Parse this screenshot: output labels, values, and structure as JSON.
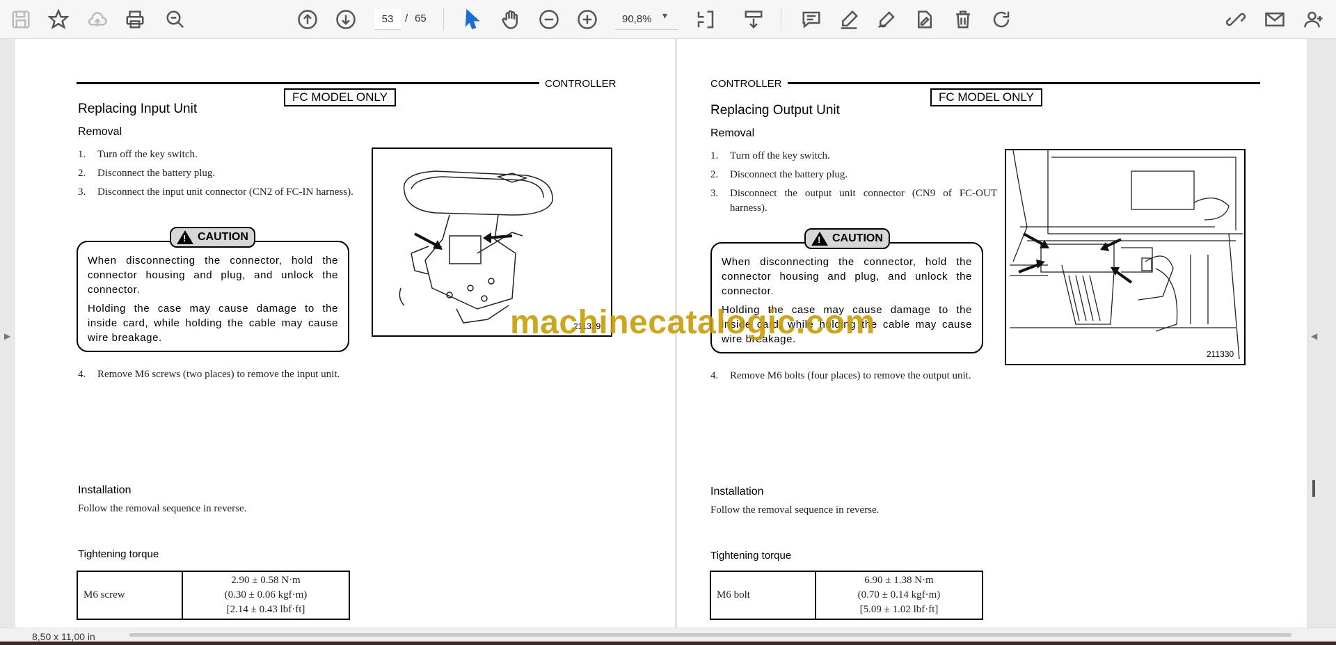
{
  "toolbar": {
    "icons": [
      "save-icon",
      "star-icon",
      "cloud-upload-icon",
      "print-icon",
      "zoom-search-icon",
      "page-up-icon",
      "page-down-icon",
      "pointer-icon",
      "hand-icon",
      "zoom-out-icon",
      "zoom-in-icon",
      "fit-page-icon",
      "scroll-mode-icon",
      "comment-icon",
      "highlight-pen-icon",
      "draw-icon",
      "sign-icon",
      "delete-icon",
      "rotate-icon",
      "share-link-icon",
      "email-icon",
      "add-user-icon"
    ],
    "page_current": "53",
    "page_sep": "/",
    "page_total": "65",
    "zoom": "90,8%",
    "zoom_dropdown": "▾"
  },
  "left_page": {
    "header": "CONTROLLER",
    "fc_model": "FC MODEL ONLY",
    "title": "Replacing Input Unit",
    "removal_heading": "Removal",
    "steps": [
      {
        "num": "1.",
        "text": "Turn off the key switch."
      },
      {
        "num": "2.",
        "text": "Disconnect the battery plug."
      },
      {
        "num": "3.",
        "text": "Disconnect the input unit connector (CN2 of FC-IN harness)."
      }
    ],
    "caution_label": "CAUTION",
    "caution_p1": "When disconnecting the connector, hold the connector housing and plug, and unlock the connector.",
    "caution_p2": "Holding the case may cause damage to the inside card, while holding the cable may cause wire breakage.",
    "step4_num": "4.",
    "step4_text": "Remove M6 screws (two places) to remove the input unit.",
    "figure_number": "211329",
    "installation_heading": "Installation",
    "installation_text": "Follow the removal sequence in reverse.",
    "torque_heading": "Tightening torque",
    "torque_label": "M6 screw",
    "torque_line1": "2.90 ± 0.58 N·m",
    "torque_line2": "(0.30 ± 0.06 kgf·m)",
    "torque_line3": "[2.14 ± 0.43 lbf·ft]"
  },
  "right_page": {
    "header": "CONTROLLER",
    "fc_model": "FC MODEL ONLY",
    "title": "Replacing Output Unit",
    "removal_heading": "Removal",
    "steps": [
      {
        "num": "1.",
        "text": "Turn off the key switch."
      },
      {
        "num": "2.",
        "text": "Disconnect the battery plug."
      },
      {
        "num": "3.",
        "text": "Disconnect the output unit connector (CN9 of FC-OUT harness)."
      }
    ],
    "caution_label": "CAUTION",
    "caution_p1": "When disconnecting the connector, hold the connector housing and plug, and unlock the connector.",
    "caution_p2": "Holding the case may cause damage to the inside card, while holding the cable may cause wire breakage.",
    "step4_num": "4.",
    "step4_text": "Remove M6 bolts (four places) to remove the output unit.",
    "figure_number": "211330",
    "installation_heading": "Installation",
    "installation_text": "Follow the removal sequence in reverse.",
    "torque_heading": "Tightening torque",
    "torque_label": "M6 bolt",
    "torque_line1": "6.90 ± 1.38 N·m",
    "torque_line2": "(0.70 ± 0.14 kgf·m)",
    "torque_line3": "[5.09 ± 1.02 lbf·ft]"
  },
  "watermark": "machinecatalogic.com",
  "status": {
    "page_size": "8,50 x 11,00 in"
  }
}
